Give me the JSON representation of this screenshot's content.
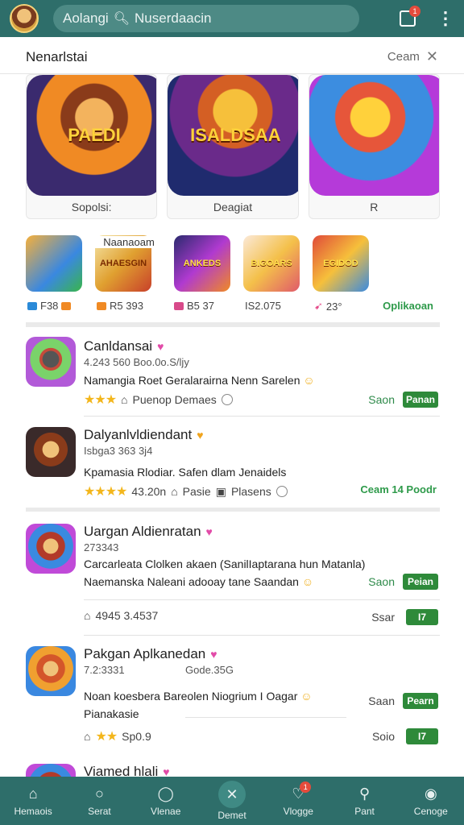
{
  "topbar": {
    "search_text_left": "Aolangi",
    "search_text_right": "Nuserdaacin",
    "notification_count": "1"
  },
  "section": {
    "title": "Nenarlstai",
    "right_label": "Ceam"
  },
  "featured": [
    {
      "label": "Sopolsi:",
      "art": "PAEDI"
    },
    {
      "label": "Deagiat",
      "art": "ISALDSAA"
    },
    {
      "label": "R",
      "art": ""
    }
  ],
  "small_row": {
    "top_label": "Naanaoam",
    "icons": [
      {
        "art": "",
        "meta": "F38",
        "meta2": ""
      },
      {
        "art": "AHAESGIN",
        "meta": "R5 393"
      },
      {
        "art": "ANKEDS",
        "meta": "B5 37"
      },
      {
        "art": "BIGOARS",
        "meta": "IS2.075"
      },
      {
        "art": "EGIDOD",
        "meta": "23°"
      }
    ],
    "action": "Oplikaoan"
  },
  "items": [
    {
      "name": "Canldansai",
      "sub": "4.243 560 Boo.0o.S/ljy",
      "desc": "Namangia Roet Geralarairna Nenn Sarelen",
      "meta_text": "Puenop Demaes",
      "action_label": "Saon",
      "action_btn": "Panan"
    },
    {
      "name": "Dalyanlvldiendant",
      "sub": "Isbga3 363 3j4",
      "desc": "Kpamasia Rlodiar. Safen dlam Jenaidels",
      "meta_text": "43.20n",
      "meta_text2": "Pasie",
      "meta_text3": "Plasens",
      "action_combo": "Ceam 14 Poodr"
    },
    {
      "name": "Uargan Aldienratan",
      "sub": "273343",
      "desc": "Carcarleata Clolken akaen (SanilIaptarana hun Matanla)",
      "desc2": "Naemanska Naleani adooay tane Saandan",
      "action_label": "Saon",
      "action_btn": "Peian",
      "meta_text": "4945 3.4537",
      "action_label2": "Ssar",
      "action_btn2": "I7"
    },
    {
      "name": "Pakgan Aplkanedan",
      "sub": "7.2:3331",
      "sub2": "Gode.35G",
      "desc": "Noan koesbera Bareolen Niogrium I Oagar",
      "desc2": "Pianakasie",
      "action_label": "Saan",
      "action_btn": "Pearn",
      "meta_text": "Sp0.9",
      "action_label2": "Soio",
      "action_btn2": "I7"
    },
    {
      "name": "Viamed hlali"
    }
  ],
  "bottom_nav": [
    {
      "label": "Hemaois"
    },
    {
      "label": "Serat"
    },
    {
      "label": "Vlenae"
    },
    {
      "label": "Demet"
    },
    {
      "label": "Vlogge",
      "badge": "1"
    },
    {
      "label": "Pant"
    },
    {
      "label": "Cenoge"
    }
  ]
}
